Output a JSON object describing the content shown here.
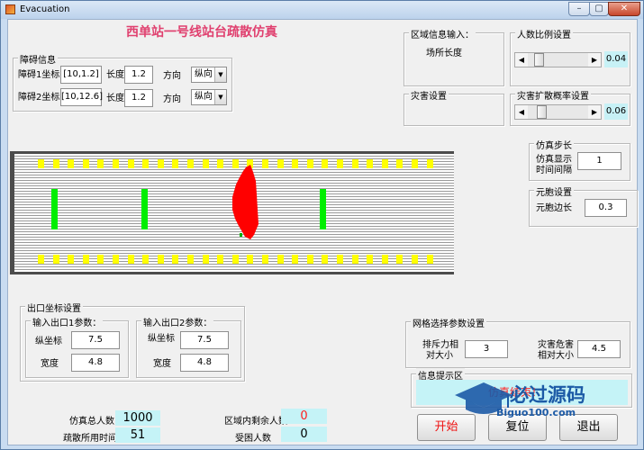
{
  "window": {
    "title": "Evacuation",
    "minimize": "–",
    "maximize": "▢",
    "close": "✕"
  },
  "main": {
    "title": "西单站一号线站台疏散仿真"
  },
  "obstacles": {
    "panel_title": "障碍信息",
    "rows": [
      {
        "coord_label": "障碍1坐标",
        "coord": "[10,1.2]",
        "len_label": "长度",
        "len": "1.2",
        "dir_label": "方向",
        "dir": "纵向"
      },
      {
        "coord_label": "障碍2坐标",
        "coord": "[10,12.6]",
        "len_label": "长度",
        "len": "1.2",
        "dir_label": "方向",
        "dir": "纵向"
      }
    ]
  },
  "area": {
    "panel_title": "区域信息输入：",
    "venue_label": "场所长度"
  },
  "ratio": {
    "panel_title": "人数比例设置",
    "value": "0.04",
    "level": 0.04
  },
  "disaster": {
    "panel_title": "灾害设置"
  },
  "spread": {
    "panel_title": "灾害扩散概率设置",
    "value": "0.06",
    "level": 0.06
  },
  "step": {
    "panel_title": "仿真步长",
    "label_line1": "仿真显示",
    "label_line2": "时间间隔",
    "value": "1"
  },
  "cell": {
    "panel_title": "元胞设置",
    "label": "元胞边长",
    "value": "0.3"
  },
  "exits": {
    "panel_title": "出口坐标设置",
    "exit1": {
      "title": "输入出口1参数：",
      "y_label": "纵坐标",
      "y": "7.5",
      "w_label": "宽度",
      "w": "4.8"
    },
    "exit2": {
      "title": "输入出口2参数：",
      "y_label": "纵坐标",
      "y": "7.5",
      "w_label": "宽度",
      "w": "4.8"
    }
  },
  "grid": {
    "panel_title": "网格选择参数设置",
    "rep_line1": "排斥力相",
    "rep_line2": "对大小",
    "rep": "3",
    "haz_line1": "灾害危害",
    "haz_line2": "相对大小",
    "haz": "4.5"
  },
  "info": {
    "panel_title": "信息提示区",
    "message": "仿真结束！"
  },
  "stats": {
    "total_label": "仿真总人数",
    "total": "1000",
    "time_label": "疏散所用时间",
    "time": "51",
    "remain_label": "区域内剩余人数",
    "remain": "0",
    "trapped_label": "受困人数",
    "trapped": "0"
  },
  "buttons": {
    "start": "开始",
    "reset": "复位",
    "exit": "退出"
  },
  "watermark": {
    "text_cn": "必过源码",
    "url": "Biguo100.com"
  },
  "colors": {
    "title": "#e0406f",
    "start_text": "#ee1111",
    "info_text": "#ff2020",
    "fire": "#ff0000",
    "obstacle": "#00ee00",
    "exit_mark": "#ffff00",
    "value_bg": "#c5f3f7"
  }
}
